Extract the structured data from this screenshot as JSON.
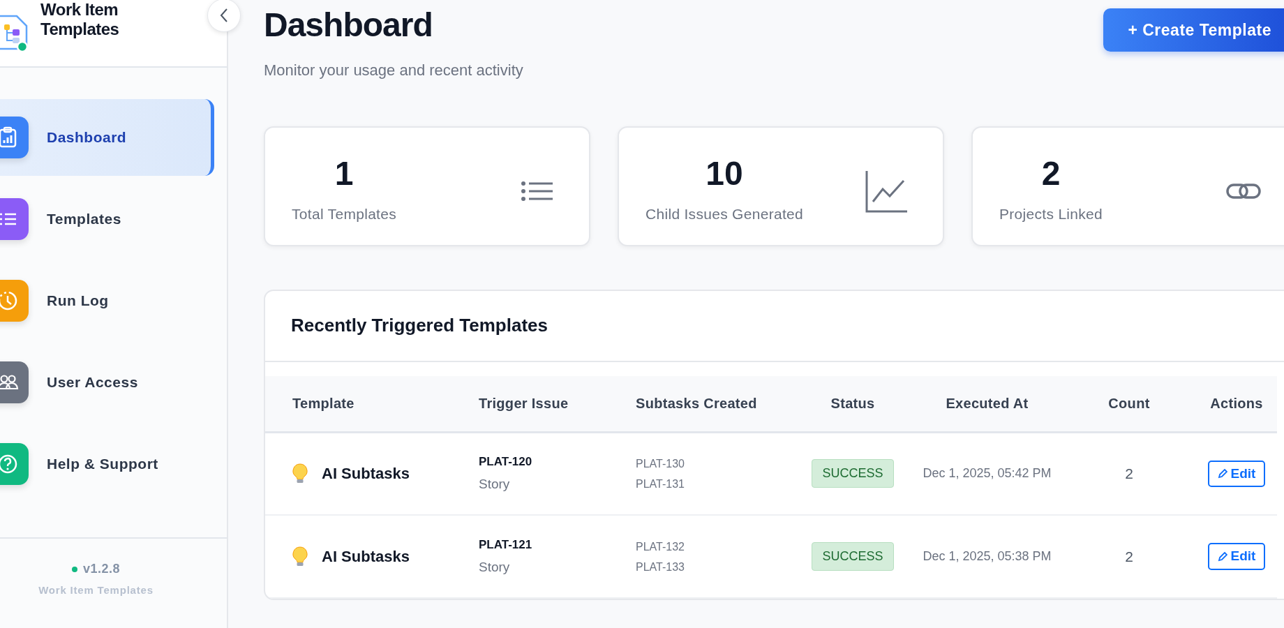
{
  "sidebar": {
    "title": "Work Item Templates",
    "items": [
      {
        "label": "Dashboard",
        "kind": "dashboard",
        "color": "#3b82f6",
        "selected": true
      },
      {
        "label": "Templates",
        "kind": "templates",
        "color": "#8b5cf6",
        "selected": false
      },
      {
        "label": "Run Log",
        "kind": "runlog",
        "color": "#f59e0b",
        "selected": false
      },
      {
        "label": "User Access",
        "kind": "users",
        "color": "#6b7280",
        "selected": false
      },
      {
        "label": "Help & Support",
        "kind": "help",
        "color": "#10b981",
        "selected": false
      }
    ],
    "version": "v1.2.8",
    "footer_name": "Work Item Templates"
  },
  "page": {
    "title": "Dashboard",
    "subtitle": "Monitor your usage and recent activity",
    "create_button": "+ Create Template"
  },
  "stats": [
    {
      "value": "1",
      "label": "Total Templates",
      "kind": "list"
    },
    {
      "value": "10",
      "label": "Child Issues Generated",
      "kind": "chart"
    },
    {
      "value": "2",
      "label": "Projects Linked",
      "kind": "link"
    }
  ],
  "recent": {
    "title": "Recently Triggered Templates",
    "columns": [
      "Template",
      "Trigger Issue",
      "Subtasks Created",
      "Status",
      "Executed At",
      "Count",
      "Actions"
    ],
    "rows": [
      {
        "template": "AI Subtasks",
        "trigger_issue": "PLAT-120",
        "issue_type": "Story",
        "subtasks": [
          "PLAT-130",
          "PLAT-131"
        ],
        "status": {
          "text": "SUCCESS",
          "kind": "success"
        },
        "executed_at": "Dec 1, 2025, 05:42 PM",
        "count": "2",
        "action": "Edit"
      },
      {
        "template": "AI Subtasks",
        "trigger_issue": "PLAT-121",
        "issue_type": "Story",
        "subtasks": [
          "PLAT-132",
          "PLAT-133"
        ],
        "status": {
          "text": "SUCCESS",
          "kind": "success"
        },
        "executed_at": "Dec 1, 2025, 05:38 PM",
        "count": "2",
        "action": "Edit"
      }
    ]
  }
}
